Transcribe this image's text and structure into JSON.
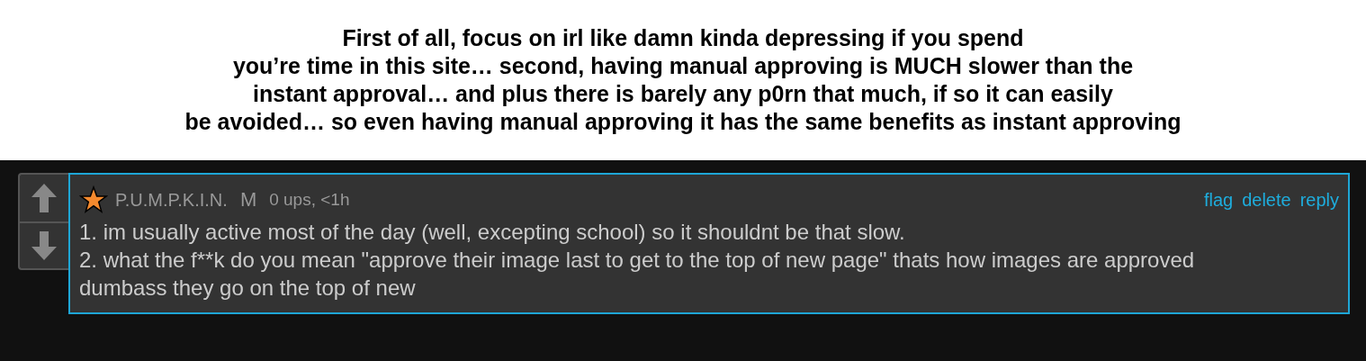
{
  "caption": [
    "First of all, focus on irl like damn kinda depressing if you spend",
    "you’re time in this site… second, having manual approving is MUCH slower than the",
    "instant approval… and plus there is barely any p0rn that much, if so it can easily",
    "be avoided… so even having manual approving it has the same benefits as instant approving"
  ],
  "comment": {
    "username": "P.U.M.P.K.I.N.",
    "badge": "M",
    "meta": "0 ups, <1h",
    "actions": [
      "flag",
      "delete",
      "reply"
    ],
    "lines": [
      "1. im usually active most of the day (well, excepting school) so it shouldnt be that slow.",
      "2. what the f**k do you mean \"approve their image last to get to the top of new page\" thats how images are approved dumbass they go on the top of new"
    ]
  }
}
